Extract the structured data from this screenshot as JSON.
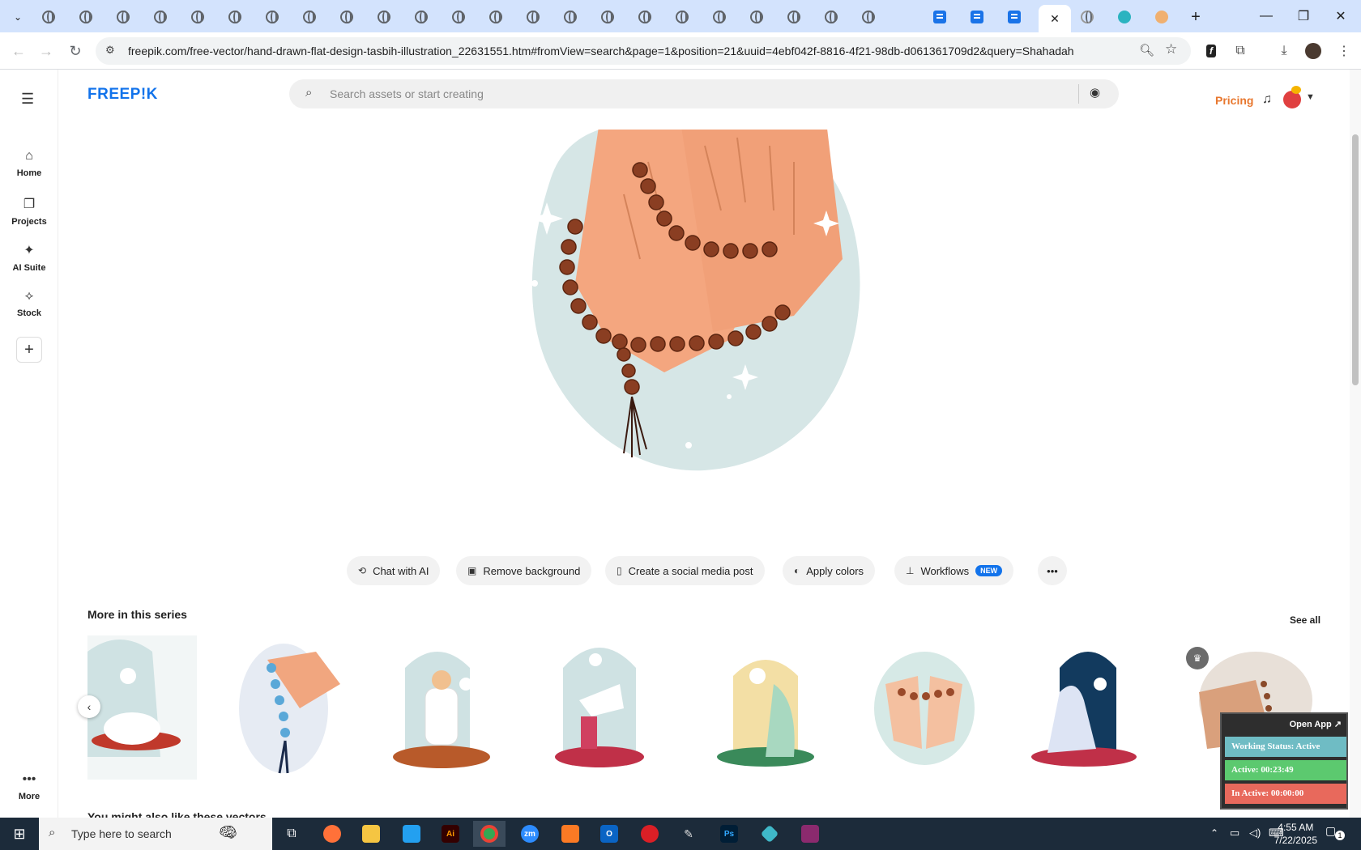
{
  "browser": {
    "url": "freepik.com/free-vector/hand-drawn-flat-design-tasbih-illustration_22631551.htm#fromView=search&page=1&position=21&uuid=4ebf042f-8816-4f21-98db-d061361709d2&query=Shahadah",
    "window_buttons": {
      "minimize": "—",
      "maximize": "❐",
      "close": "✕"
    }
  },
  "site": {
    "logo": "FREEP!K",
    "search_placeholder": "Search assets or start creating",
    "pricing": "Pricing"
  },
  "sidebar": {
    "items": [
      {
        "label": "Home",
        "icon": "home-icon"
      },
      {
        "label": "Projects",
        "icon": "projects-icon"
      },
      {
        "label": "AI Suite",
        "icon": "sparkle-icon"
      },
      {
        "label": "Stock",
        "icon": "stock-icon"
      }
    ],
    "more": "More"
  },
  "actions": {
    "chat_ai": "Chat with AI",
    "remove_bg": "Remove background",
    "social_post": "Create a social media post",
    "apply_colors": "Apply colors",
    "workflows": "Workflows",
    "new_badge": "NEW"
  },
  "series": {
    "title": "More in this series",
    "see_all": "See all"
  },
  "also_like": "You might also like these vectors",
  "widget": {
    "open_app": "Open App ↗",
    "status": "Working Status: Active",
    "active": "Active: 00:23:49",
    "inactive": "In Active: 00:00:00"
  },
  "taskbar": {
    "search_placeholder": "Type here to search",
    "time": "4:55 AM",
    "date": "7/22/2025",
    "notification_count": "1"
  },
  "colors": {
    "brand_blue": "#1273eb",
    "pricing_orange": "#e8772e",
    "status_active": "#6fbcc4",
    "active_green": "#5cc96f",
    "inactive_red": "#e8695c"
  }
}
